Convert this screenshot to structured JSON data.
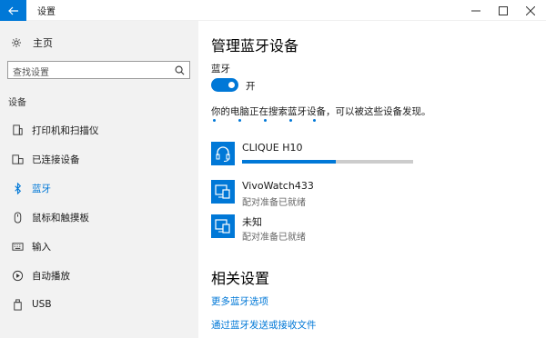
{
  "window": {
    "title": "设置"
  },
  "sidebar": {
    "home_label": "主页",
    "search_placeholder": "查找设置",
    "section_label": "设备",
    "items": [
      {
        "label": "打印机和扫描仪",
        "icon": "printer-icon"
      },
      {
        "label": "已连接设备",
        "icon": "connected-devices-icon"
      },
      {
        "label": "蓝牙",
        "icon": "bluetooth-icon",
        "active": true
      },
      {
        "label": "鼠标和触摸板",
        "icon": "mouse-icon"
      },
      {
        "label": "输入",
        "icon": "keyboard-icon"
      },
      {
        "label": "自动播放",
        "icon": "autoplay-icon"
      },
      {
        "label": "USB",
        "icon": "usb-icon"
      }
    ]
  },
  "main": {
    "title": "管理蓝牙设备",
    "bluetooth_label": "蓝牙",
    "toggle_state": "开",
    "toggle_on": true,
    "searching_text": "你的电脑正在搜索蓝牙设备，可以被这些设备发现。",
    "devices": [
      {
        "name": "CLIQUE H10",
        "status": "",
        "icon": "headset-icon",
        "connecting_progress": 0.55
      },
      {
        "name": "VivoWatch433",
        "status": "配对准备已就绪",
        "icon": "device-icon"
      },
      {
        "name": "未知",
        "status": "配对准备已就绪",
        "icon": "device-icon"
      }
    ],
    "related_title": "相关设置",
    "links": [
      "更多蓝牙选项",
      "通过蓝牙发送或接收文件"
    ]
  },
  "colors": {
    "accent": "#0078d7",
    "sidebar_bg": "#f2f2f2",
    "muted_text": "#666666"
  }
}
